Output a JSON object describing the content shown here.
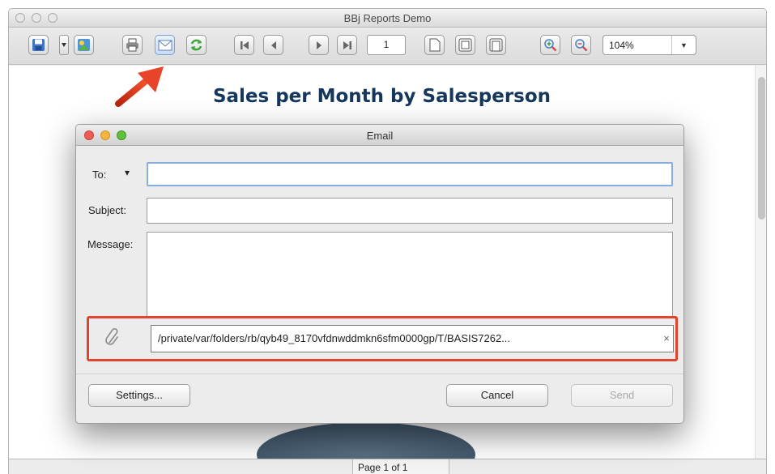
{
  "window": {
    "title": "BBj Reports Demo"
  },
  "toolbar": {
    "page_number": "1",
    "zoom": "104%",
    "zoom_arrow": "▼"
  },
  "report": {
    "title": "Sales per Month by Salesperson"
  },
  "status": {
    "page": "Page 1 of 1"
  },
  "email_dialog": {
    "title": "Email",
    "to_label": "To:",
    "to_dropdown": "▾",
    "to_value": "",
    "subject_label": "Subject:",
    "subject_value": "",
    "message_label": "Message:",
    "message_value": "",
    "attachment_path": "/private/var/folders/rb/qyb49_8170vfdnwddmkn6sfm0000gp/T/BASIS7262...",
    "remove_glyph": "×",
    "settings_label": "Settings...",
    "cancel_label": "Cancel",
    "send_label": "Send"
  },
  "colors": {
    "highlight": "#e2432c",
    "report_title": "#16375c",
    "close_light": "#ee5c54",
    "minimize_light": "#f5b53d",
    "zoom_light": "#5fc13b"
  },
  "icons": [
    "save-icon",
    "dropdown-arrow-icon",
    "export-icon",
    "print-icon",
    "email-icon",
    "refresh-icon",
    "first-page-icon",
    "prev-page-icon",
    "next-page-icon",
    "last-page-icon",
    "single-page-icon",
    "fit-page-icon",
    "fit-width-icon",
    "zoom-in-icon",
    "zoom-out-icon",
    "paperclip-icon",
    "red-arrow-annotation"
  ]
}
